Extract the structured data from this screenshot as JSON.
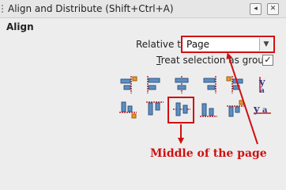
{
  "window": {
    "title": "Align and Distribute (Shift+Ctrl+A)"
  },
  "section": {
    "title": "Align"
  },
  "relative_to": {
    "label": "Relative to:",
    "value": "Page"
  },
  "treat_selection": {
    "label_mnemonic": "T",
    "label_rest": "reat selection as group:",
    "checked": true,
    "mark": "✓"
  },
  "annotation": {
    "text": "Middle of  the page",
    "color": "#d01010"
  },
  "colors": {
    "highlight": "#d01010",
    "icon_blue": "#5d8fc2",
    "icon_orange": "#e89a2a",
    "icon_red_guide": "#c82020"
  },
  "icons": [
    "align-right-edge-to-left-anchor-icon",
    "align-left-edges-icon",
    "center-on-vertical-axis-icon",
    "align-right-edges-icon",
    "align-left-edge-to-right-anchor-icon",
    "align-baseline-text-vertical-icon",
    "align-bottom-edge-to-top-anchor-icon",
    "align-top-edges-icon",
    "center-on-horizontal-axis-icon",
    "align-bottom-edges-icon",
    "align-top-edge-to-bottom-anchor-icon",
    "align-baseline-text-horizontal-icon"
  ]
}
